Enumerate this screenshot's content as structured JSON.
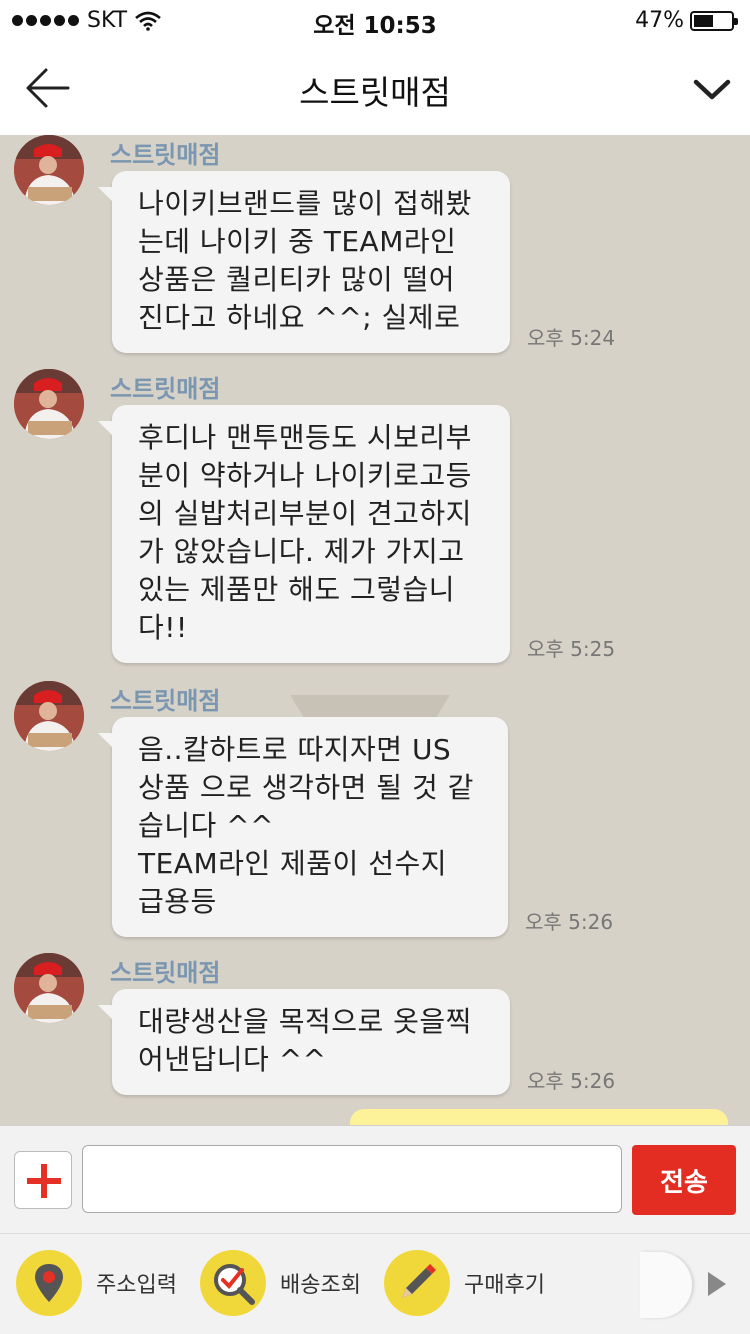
{
  "status": {
    "carrier": "SKT",
    "time": "오전 10:53",
    "battery": "47%",
    "battery_level": 0.47
  },
  "header": {
    "title": "스트릿매점"
  },
  "messages": [
    {
      "sender": "스트릿매점",
      "text": "나이키브랜드를 많이 접해봤\n는데 나이키 중 TEAM라인\n상품은 퀄리티카 많이 떨어\n진다고 하네요 ^^; 실제로",
      "time": "오후 5:24"
    },
    {
      "sender": "스트릿매점",
      "text": "후디나 맨투맨등도 시보리부\n분이 약하거나 나이키로고등\n의 실밥처리부분이 견고하지\n가 않았습니다. 제가 가지고\n있는 제품만 해도 그렇습니\n다!!",
      "time": "오후 5:25"
    },
    {
      "sender": "스트릿매점",
      "text": "음..칼하트로 따지자면 US\n상품 으로 생각하면 될 것 같\n습니다 ^^\nTEAM라인 제품이 선수지\n급용등",
      "time": "오후 5:26"
    },
    {
      "sender": "스트릿매점",
      "text": "대량생산을 목적으로 옷을찍\n어낸답니다 ^^",
      "time": "오후 5:26"
    }
  ],
  "input": {
    "value": "",
    "send_label": "전송"
  },
  "tools": [
    {
      "label": "주소입력",
      "icon": "location-pin-icon"
    },
    {
      "label": "배송조회",
      "icon": "delivery-search-icon"
    },
    {
      "label": "구매후기",
      "icon": "review-pencil-icon"
    }
  ],
  "colors": {
    "chat_bg": "#d7d2c8",
    "sender_name": "#7a96b0",
    "send_button": "#e32c22",
    "tool_circle": "#f1d83a",
    "my_bubble": "#fdf29a"
  }
}
